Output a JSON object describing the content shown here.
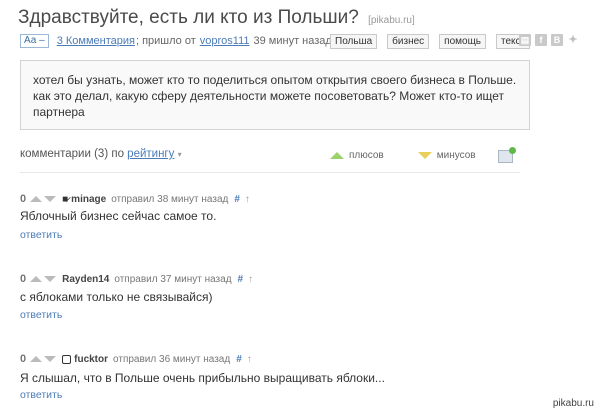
{
  "post": {
    "title": "Здравствуйте, есть ли кто из Польши?",
    "source": "[pikabu.ru]",
    "font_toggle": "Аа –",
    "comments_link": "3 Комментария",
    "posted_by_prefix": "; пришло от",
    "author": "vopros111",
    "time": "39 минут назад",
    "tags": [
      "Польша",
      "бизнес",
      "помощь",
      "текст"
    ],
    "share_icons": [
      "bookmark-icon",
      "facebook-icon",
      "vkontakte-icon",
      "twitter-icon"
    ],
    "body": "хотел бы узнать, может кто то поделиться опытом открытия своего бизнеса в Польше. как это делал, какую сферу деятельности можете посоветовать? Может кто-то ищет партнера"
  },
  "comments_header": {
    "prefix": "комментарии (3) по",
    "sort": "рейтингу",
    "pluses": "плюсов",
    "minuses": "минусов"
  },
  "comments": [
    {
      "rating": "0",
      "user": "minage",
      "sent": "отправил 38 минут назад",
      "hash": "#",
      "text": "Яблочный бизнес сейчас самое то.",
      "reply": "ответить"
    },
    {
      "rating": "0",
      "user": "Rayden14",
      "sent": "отправил 37 минут назад",
      "hash": "#",
      "text": "с яблоками только не связывайся)",
      "reply": "ответить"
    },
    {
      "rating": "0",
      "user": "fucktor",
      "sent": "отправил 36 минут назад",
      "hash": "#",
      "text": "Я слышал, что в Польше очень прибыльно выращивать яблоки...",
      "reply": "ответить"
    }
  ],
  "watermark": "pikabu.ru",
  "colors": {
    "link": "#4a7bb7",
    "plus": "#9bd36a",
    "minus": "#e8d05a"
  }
}
